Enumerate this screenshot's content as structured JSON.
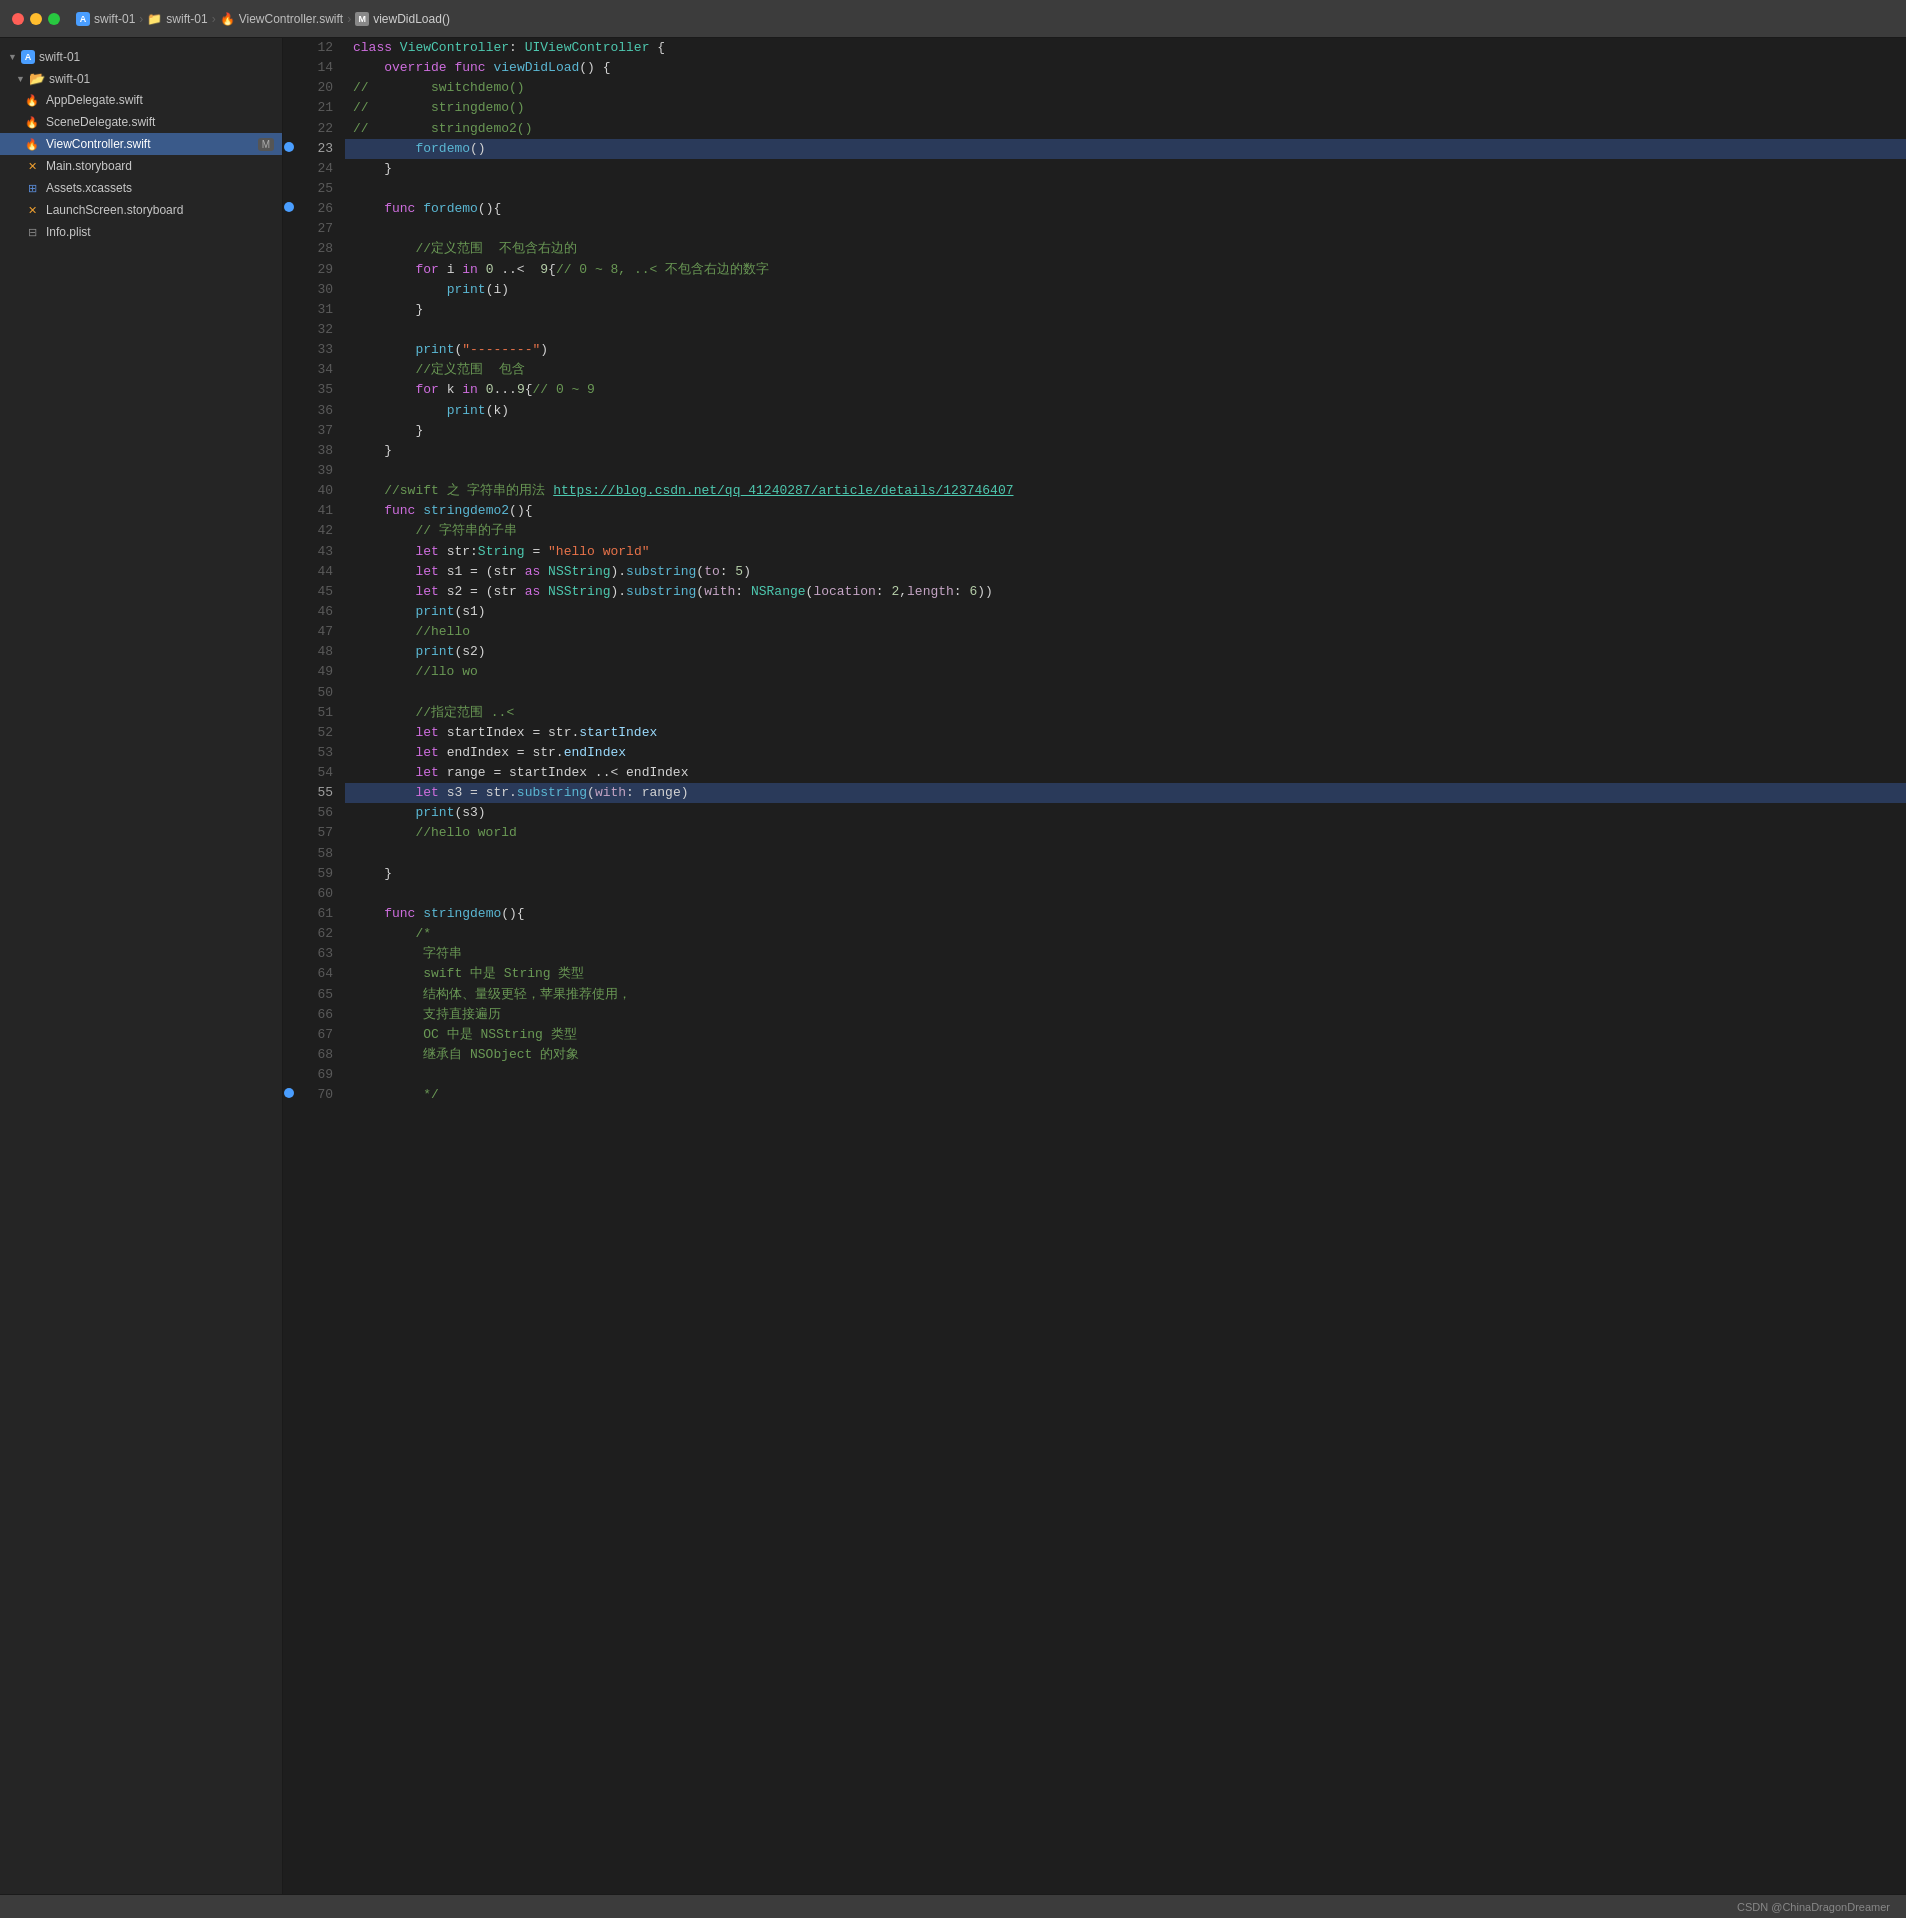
{
  "titlebar": {
    "project": "swift-01",
    "path1": "swift-01",
    "path2": "ViewController.swift",
    "path3": "viewDidLoad()"
  },
  "sidebar": {
    "project_label": "swift-01",
    "group_label": "swift-01",
    "items": [
      {
        "label": "AppDelegate.swift",
        "type": "swift",
        "indent": 2
      },
      {
        "label": "SceneDelegate.swift",
        "type": "swift",
        "indent": 2
      },
      {
        "label": "ViewController.swift",
        "type": "swift",
        "indent": 2,
        "active": true,
        "badge": "M"
      },
      {
        "label": "Main.storyboard",
        "type": "storyboard",
        "indent": 2
      },
      {
        "label": "Assets.xcassets",
        "type": "assets",
        "indent": 2
      },
      {
        "label": "LaunchScreen.storyboard",
        "type": "storyboard",
        "indent": 2
      },
      {
        "label": "Info.plist",
        "type": "plist",
        "indent": 2
      }
    ]
  },
  "code": {
    "lines": [
      {
        "num": 12,
        "content": "class ViewController: UIViewController {",
        "type": "normal"
      },
      {
        "num": 14,
        "content": "    override func viewDidLoad() {",
        "type": "normal"
      },
      {
        "num": 20,
        "content": "//        switchdemo()",
        "type": "comment_line"
      },
      {
        "num": 21,
        "content": "//        stringdemo()",
        "type": "comment_line"
      },
      {
        "num": 22,
        "content": "//        stringdemo2()",
        "type": "comment_line"
      },
      {
        "num": 23,
        "content": "        fordemo()",
        "type": "highlighted",
        "breakpoint": true
      },
      {
        "num": 24,
        "content": "    }",
        "type": "normal"
      },
      {
        "num": 25,
        "content": "",
        "type": "normal"
      },
      {
        "num": 26,
        "content": "    func fordemo(){",
        "type": "normal",
        "breakpoint": true
      },
      {
        "num": 27,
        "content": "",
        "type": "normal"
      },
      {
        "num": 28,
        "content": "        //定义范围  不包含右边的",
        "type": "comment_line"
      },
      {
        "num": 29,
        "content": "        for i in 0 ..<  9{// 0 ~ 8, ..< 不包含右边的数字",
        "type": "normal"
      },
      {
        "num": 30,
        "content": "            print(i)",
        "type": "normal"
      },
      {
        "num": 31,
        "content": "        }",
        "type": "normal"
      },
      {
        "num": 32,
        "content": "",
        "type": "normal"
      },
      {
        "num": 33,
        "content": "        print(\"--------\")",
        "type": "normal"
      },
      {
        "num": 34,
        "content": "        //定义范围  包含",
        "type": "comment_line"
      },
      {
        "num": 35,
        "content": "        for k in 0...9{// 0 ~ 9",
        "type": "normal"
      },
      {
        "num": 36,
        "content": "            print(k)",
        "type": "normal"
      },
      {
        "num": 37,
        "content": "        }",
        "type": "normal"
      },
      {
        "num": 38,
        "content": "    }",
        "type": "normal"
      },
      {
        "num": 39,
        "content": "",
        "type": "normal"
      },
      {
        "num": 40,
        "content": "    //swift 之 字符串的用法 https://blog.csdn.net/qq_41240287/article/details/123746407",
        "type": "comment_link"
      },
      {
        "num": 41,
        "content": "    func stringdemo2(){",
        "type": "normal"
      },
      {
        "num": 42,
        "content": "        // 字符串的子串",
        "type": "comment_line"
      },
      {
        "num": 43,
        "content": "        let str:String = \"hello world\"",
        "type": "normal"
      },
      {
        "num": 44,
        "content": "        let s1 = (str as NSString).substring(to: 5)",
        "type": "normal"
      },
      {
        "num": 45,
        "content": "        let s2 = (str as NSString).substring(with: NSRange(location: 2,length: 6))",
        "type": "normal"
      },
      {
        "num": 46,
        "content": "        print(s1)",
        "type": "normal"
      },
      {
        "num": 47,
        "content": "        //hello",
        "type": "comment_line"
      },
      {
        "num": 48,
        "content": "        print(s2)",
        "type": "normal"
      },
      {
        "num": 49,
        "content": "        //llo wo",
        "type": "comment_line"
      },
      {
        "num": 50,
        "content": "",
        "type": "normal"
      },
      {
        "num": 51,
        "content": "        //指定范围 ..<",
        "type": "comment_line"
      },
      {
        "num": 52,
        "content": "        let startIndex = str.startIndex",
        "type": "normal"
      },
      {
        "num": 53,
        "content": "        let endIndex = str.endIndex",
        "type": "normal"
      },
      {
        "num": 54,
        "content": "        let range = startIndex ..< endIndex",
        "type": "normal"
      },
      {
        "num": 55,
        "content": "        let s3 = str.substring(with: range)",
        "type": "highlighted"
      },
      {
        "num": 56,
        "content": "        print(s3)",
        "type": "normal"
      },
      {
        "num": 57,
        "content": "        //hello world",
        "type": "comment_line"
      },
      {
        "num": 58,
        "content": "",
        "type": "normal"
      },
      {
        "num": 59,
        "content": "    }",
        "type": "normal"
      },
      {
        "num": 60,
        "content": "",
        "type": "normal"
      },
      {
        "num": 61,
        "content": "    func stringdemo(){",
        "type": "normal"
      },
      {
        "num": 62,
        "content": "        /*",
        "type": "comment_line"
      },
      {
        "num": 63,
        "content": "         字符串",
        "type": "comment_line"
      },
      {
        "num": 64,
        "content": "         swift 中是 String 类型",
        "type": "comment_line"
      },
      {
        "num": 65,
        "content": "         结构体、量级更轻，苹果推荐使用，",
        "type": "comment_line"
      },
      {
        "num": 66,
        "content": "         支持直接遍历",
        "type": "comment_line"
      },
      {
        "num": 67,
        "content": "         OC 中是 NSString 类型",
        "type": "comment_line"
      },
      {
        "num": 68,
        "content": "         继承自 NSObject 的对象",
        "type": "comment_line"
      },
      {
        "num": 69,
        "content": "",
        "type": "normal"
      },
      {
        "num": 70,
        "content": "         */",
        "type": "comment_line"
      }
    ]
  },
  "statusbar": {
    "text": "CSDN @ChinaDragonDreamer"
  }
}
